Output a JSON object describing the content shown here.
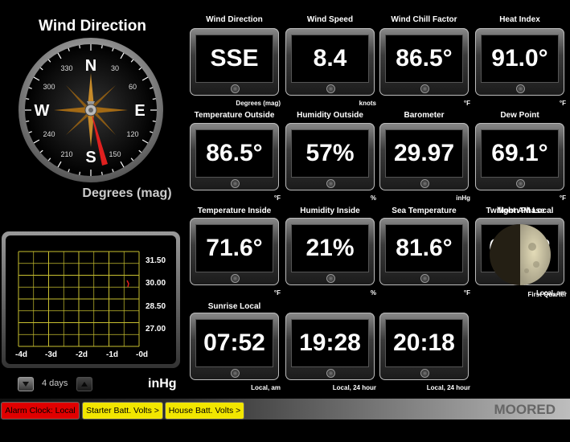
{
  "compass": {
    "title": "Wind Direction",
    "subtitle": "Degrees (mag)",
    "cardinals": {
      "n": "N",
      "e": "E",
      "s": "S",
      "w": "W"
    },
    "degree_labels": [
      "30",
      "60",
      "120",
      "150",
      "210",
      "240",
      "300",
      "330"
    ],
    "needle_color": "#e0201f"
  },
  "tiles": [
    {
      "title": "Wind Direction",
      "value": "SSE",
      "unit": "Degrees (mag)"
    },
    {
      "title": "Wind Speed",
      "value": "8.4",
      "unit": "knots"
    },
    {
      "title": "Wind Chill Factor",
      "value": "86.5°",
      "unit": "°F"
    },
    {
      "title": "Heat Index",
      "value": "91.0°",
      "unit": "°F"
    },
    {
      "title": "Temperature Outside",
      "value": "86.5°",
      "unit": "°F"
    },
    {
      "title": "Humidity Outside",
      "value": "57%",
      "unit": "%"
    },
    {
      "title": "Barometer",
      "value": "29.97",
      "unit": "inHg"
    },
    {
      "title": "Dew Point",
      "value": "69.1°",
      "unit": "°F"
    },
    {
      "title": "Temperature Inside",
      "value": "71.6°",
      "unit": "°F"
    },
    {
      "title": "Humidity Inside",
      "value": "21%",
      "unit": "%"
    },
    {
      "title": "Sea Temperature",
      "value": "81.6°",
      "unit": "°F"
    },
    {
      "title": "Twilight AM Local",
      "value": "07:02",
      "unit": "Local, am"
    },
    {
      "title": "Sunrise Local",
      "value": "07:52",
      "unit": "Local, am"
    },
    {
      "title": "",
      "value": "19:28",
      "unit": "Local, 24 hour"
    },
    {
      "title": "",
      "value": "20:18",
      "unit": "Local, 24 hour"
    }
  ],
  "moon": {
    "title": "Moon Phase",
    "phase": "First Quarter"
  },
  "graph": {
    "y_ticks": [
      "31.50",
      "30.00",
      "28.50",
      "27.00"
    ],
    "x_ticks": [
      "-4d",
      "-3d",
      "-2d",
      "-1d",
      "-0d"
    ],
    "unit": "inHg",
    "range_label": "4 days",
    "grid_color": "#c8c030"
  },
  "buttons": {
    "alarm": "Alarm Clock: Local",
    "starter": "Starter Batt. Volts >",
    "house": "House Batt. Volts >"
  },
  "status": "MOORED",
  "colors": {
    "alarm": "#e00000",
    "battery": "#f2e600"
  }
}
